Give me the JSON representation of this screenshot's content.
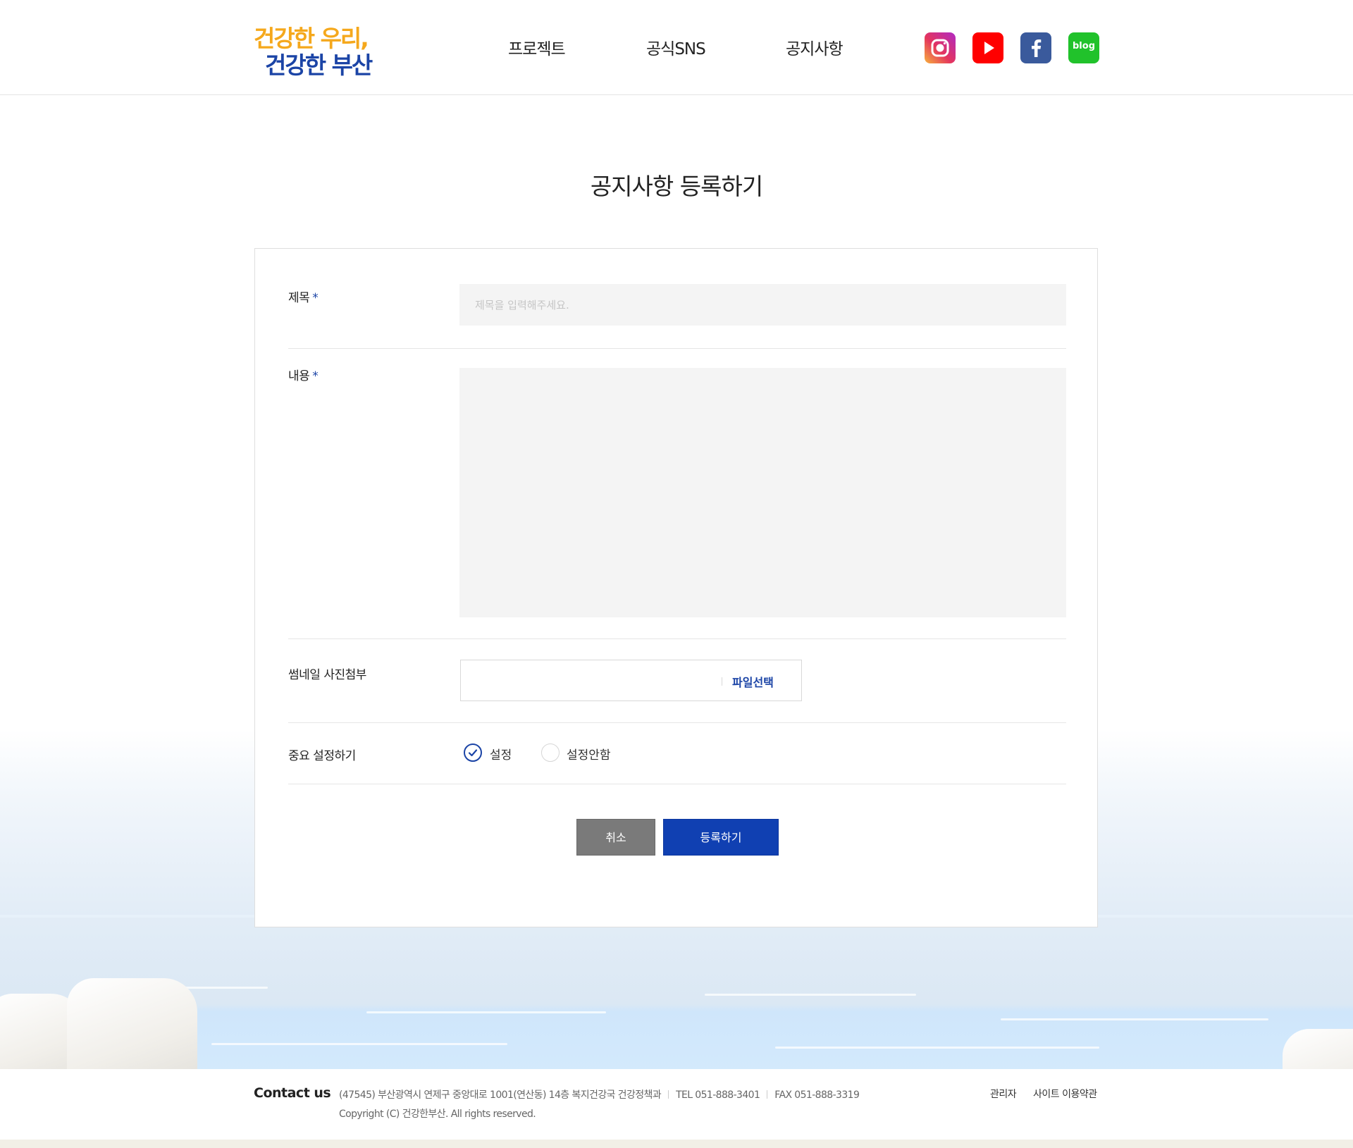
{
  "header": {
    "logo": {
      "line1": "건강한 우리,",
      "line2": "건강한 부산"
    },
    "nav": [
      {
        "label": "프로젝트"
      },
      {
        "label": "공식SNS"
      },
      {
        "label": "공지사항"
      }
    ],
    "sns": [
      {
        "icon": "instagram-icon"
      },
      {
        "icon": "youtube-icon"
      },
      {
        "icon": "facebook-icon"
      },
      {
        "icon": "blog-icon",
        "label": "blog"
      }
    ]
  },
  "page": {
    "title": "공지사항 등록하기"
  },
  "form": {
    "title_field": {
      "label": "제목",
      "required_mark": "*",
      "placeholder": "제목을 입력해주세요.",
      "value": ""
    },
    "content_field": {
      "label": "내용",
      "required_mark": "*",
      "value": ""
    },
    "thumbnail_field": {
      "label": "썸네일 사진첨부",
      "button": "파일선택"
    },
    "important_field": {
      "label": "중요 설정하기",
      "options": [
        {
          "label": "설정",
          "selected": true
        },
        {
          "label": "설정안함",
          "selected": false
        }
      ]
    },
    "buttons": {
      "cancel": "취소",
      "submit": "등록하기"
    }
  },
  "footer": {
    "contact_title": "Contact us",
    "address": "(47545) 부산광역시 연제구 중앙대로 1001(연산동) 14층 복지건강국 건강정책과",
    "tel": "TEL 051-888-3401",
    "fax": "FAX 051-888-3319",
    "copyright": "Copyright (C) 건강한부산. All rights reserved.",
    "links": [
      {
        "label": "관리자"
      },
      {
        "label": "사이트 이용약관"
      }
    ]
  },
  "colors": {
    "brand_blue": "#1b44a6",
    "brand_orange": "#f5a81c",
    "button_blue": "#1040b2",
    "button_gray": "#7a7a7a"
  }
}
